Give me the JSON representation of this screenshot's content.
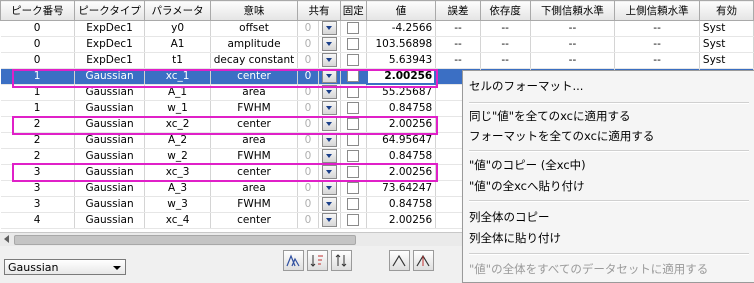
{
  "columns": [
    "ピーク番号",
    "ピークタイプ",
    "パラメータ",
    "意味",
    "共有",
    "固定",
    "値",
    "誤差",
    "依存度",
    "下側信頼水準",
    "上側信頼水準",
    "有効"
  ],
  "rows": [
    {
      "peak": "0",
      "type": "ExpDec1",
      "param": "y0",
      "meaning": "offset",
      "share": "0",
      "value": "-4.2566",
      "err": "--",
      "dep": "--",
      "lower": "--",
      "upper": "--",
      "valid": "Syst"
    },
    {
      "peak": "0",
      "type": "ExpDec1",
      "param": "A1",
      "meaning": "amplitude",
      "share": "0",
      "value": "103.56898",
      "err": "--",
      "dep": "--",
      "lower": "--",
      "upper": "--",
      "valid": "Syst"
    },
    {
      "peak": "0",
      "type": "ExpDec1",
      "param": "t1",
      "meaning": "decay constant",
      "share": "0",
      "value": "5.63943",
      "err": "--",
      "dep": "--",
      "lower": "--",
      "upper": "--",
      "valid": "Syst"
    },
    {
      "peak": "1",
      "type": "Gaussian",
      "param": "xc_1",
      "meaning": "center",
      "share": "0",
      "value": "2.00256",
      "err": "",
      "dep": "",
      "lower": "",
      "upper": "",
      "valid": ""
    },
    {
      "peak": "1",
      "type": "Gaussian",
      "param": "A_1",
      "meaning": "area",
      "share": "0",
      "value": "55.25687",
      "err": "",
      "dep": "",
      "lower": "",
      "upper": "",
      "valid": ""
    },
    {
      "peak": "1",
      "type": "Gaussian",
      "param": "w_1",
      "meaning": "FWHM",
      "share": "0",
      "value": "0.84758",
      "err": "",
      "dep": "",
      "lower": "",
      "upper": "",
      "valid": ""
    },
    {
      "peak": "2",
      "type": "Gaussian",
      "param": "xc_2",
      "meaning": "center",
      "share": "0",
      "value": "2.00256",
      "err": "",
      "dep": "",
      "lower": "",
      "upper": "",
      "valid": ""
    },
    {
      "peak": "2",
      "type": "Gaussian",
      "param": "A_2",
      "meaning": "area",
      "share": "0",
      "value": "64.95647",
      "err": "",
      "dep": "",
      "lower": "",
      "upper": "",
      "valid": ""
    },
    {
      "peak": "2",
      "type": "Gaussian",
      "param": "w_2",
      "meaning": "FWHM",
      "share": "0",
      "value": "0.84758",
      "err": "",
      "dep": "",
      "lower": "",
      "upper": "",
      "valid": ""
    },
    {
      "peak": "3",
      "type": "Gaussian",
      "param": "xc_3",
      "meaning": "center",
      "share": "0",
      "value": "2.00256",
      "err": "",
      "dep": "",
      "lower": "",
      "upper": "",
      "valid": ""
    },
    {
      "peak": "3",
      "type": "Gaussian",
      "param": "A_3",
      "meaning": "area",
      "share": "0",
      "value": "73.64247",
      "err": "",
      "dep": "",
      "lower": "",
      "upper": "",
      "valid": ""
    },
    {
      "peak": "3",
      "type": "Gaussian",
      "param": "w_3",
      "meaning": "FWHM",
      "share": "0",
      "value": "0.84758",
      "err": "",
      "dep": "",
      "lower": "",
      "upper": "",
      "valid": ""
    },
    {
      "peak": "4",
      "type": "Gaussian",
      "param": "xc_4",
      "meaning": "center",
      "share": "0",
      "value": "2.00256",
      "err": "",
      "dep": "",
      "lower": "",
      "upper": "",
      "valid": ""
    }
  ],
  "selected_row": 3,
  "highlighted_rows": [
    3,
    6,
    9
  ],
  "peak_type_select": "Gaussian",
  "toolbar_icons": [
    "peak-shape-icon",
    "sort-icon",
    "arrange-icon",
    "peak-left-icon",
    "peak-right-icon"
  ],
  "context_menu": {
    "items": [
      {
        "label": "セルのフォーマット...",
        "enabled": true
      },
      {
        "label": "同じ\"値\"を全てのxcに適用する",
        "enabled": true
      },
      {
        "label": "フォーマットを全てのxcに適用する",
        "enabled": true
      },
      {
        "label": "\"値\"のコピー (全xc中)",
        "enabled": true
      },
      {
        "label": "\"値\"の全xcへ貼り付け",
        "enabled": true
      },
      {
        "label": "列全体のコピー",
        "enabled": true
      },
      {
        "label": "列全体に貼り付け",
        "enabled": true
      },
      {
        "label": "\"値\"の全体をすべてのデータセットに適用する",
        "enabled": false
      }
    ]
  },
  "colors": {
    "selection": "#3b6fc4",
    "highlight": "#e020c8",
    "menu_bg": "#f5f5f5"
  }
}
